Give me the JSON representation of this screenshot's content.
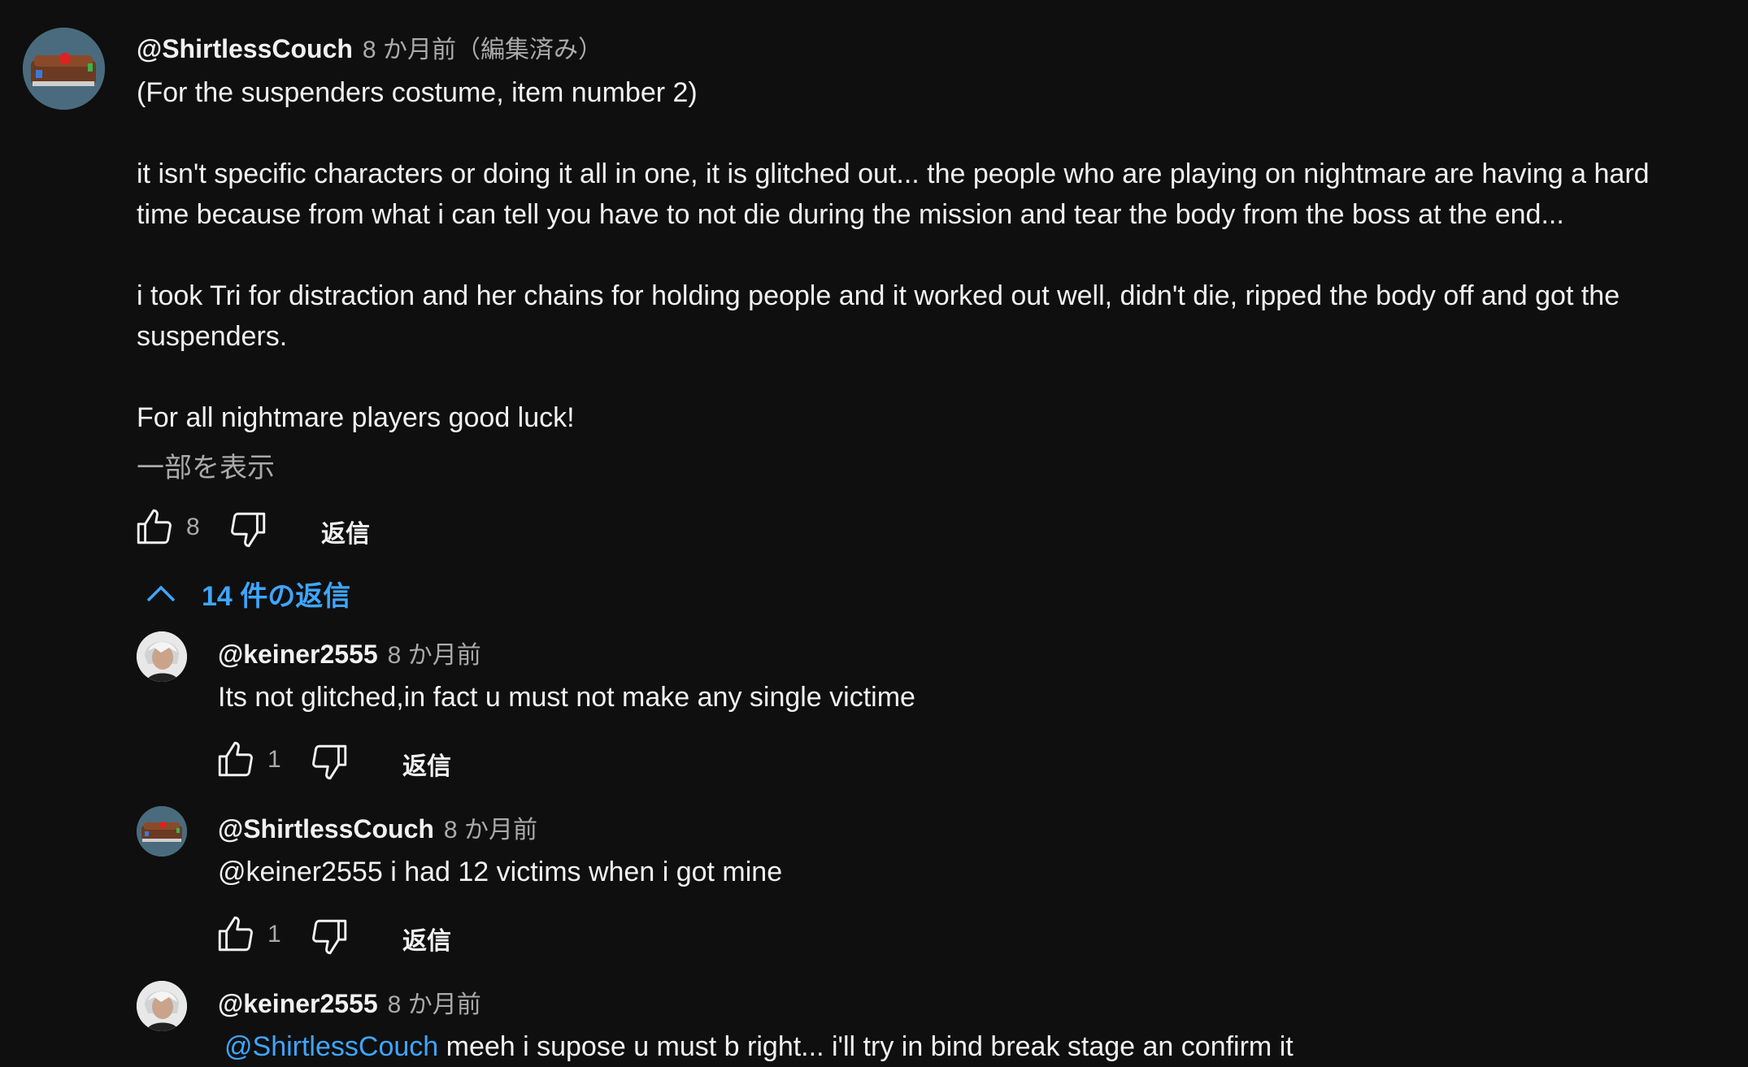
{
  "comment": {
    "author": "@ShirtlessCouch",
    "time": "8 か月前（編集済み）",
    "paragraphs": [
      "(For the suspenders costume, item number 2)",
      "it isn't specific characters or doing it all in one, it is glitched out... the people who are playing on nightmare are having a hard",
      "time because from what i can tell you have to not die during the mission and tear the body from the boss at the end...",
      "i took Tri for distraction and her chains for holding people and it worked out well, didn't die, ripped the body off and got the",
      "suspenders.",
      "For all nightmare players good luck!"
    ],
    "show_less": "一部を表示",
    "likes": "8",
    "reply_label": "返信",
    "replies_toggle": "14 件の返信"
  },
  "replies": [
    {
      "author": "@keiner2555",
      "time": "8 か月前",
      "text": "Its not glitched,in fact u must not make any single victime",
      "likes": "1",
      "reply_label": "返信"
    },
    {
      "author": "@ShirtlessCouch",
      "time": "8 か月前",
      "mention": "@keiner2555",
      "text": " i had 12 victims when i got mine",
      "likes": "1",
      "reply_label": "返信"
    },
    {
      "author": "@keiner2555",
      "time": "8 か月前",
      "mention": "@ShirtlessCouch",
      "text": " meeh i supose u must b right... i'll try in bind break stage an confirm it"
    }
  ],
  "colors": {
    "background": "#0f0f0f",
    "text": "#f1f1f1",
    "secondary": "#aaaaaa",
    "link": "#3ea6ff"
  }
}
